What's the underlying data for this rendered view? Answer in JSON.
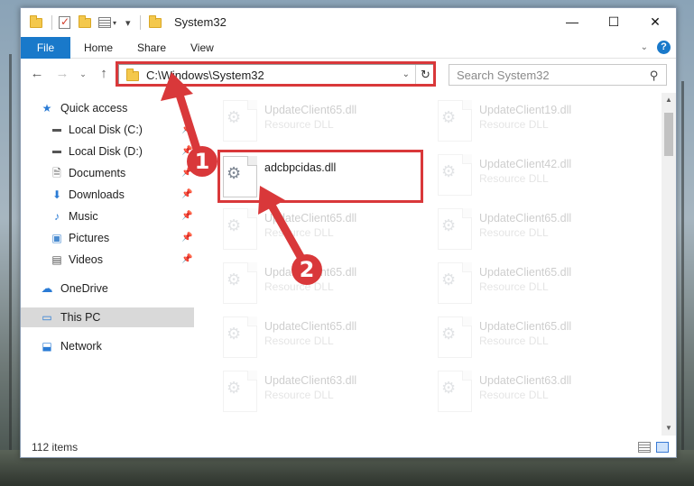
{
  "window": {
    "title": "System32",
    "controls": {
      "minimize": "—",
      "maximize": "☐",
      "close": "✕"
    }
  },
  "ribbon": {
    "file_tab": "File",
    "tabs": [
      "Home",
      "Share",
      "View"
    ],
    "help": "?"
  },
  "navbar": {
    "address": "C:\\Windows\\System32",
    "search_placeholder": "Search System32",
    "refresh": "↻"
  },
  "nav_pane": {
    "quick_access": "Quick access",
    "items": [
      {
        "label": "Local Disk (C:)",
        "pinned": true
      },
      {
        "label": "Local Disk (D:)",
        "pinned": true
      },
      {
        "label": "Documents",
        "pinned": true
      },
      {
        "label": "Downloads",
        "pinned": true
      },
      {
        "label": "Music",
        "pinned": true
      },
      {
        "label": "Pictures",
        "pinned": true
      },
      {
        "label": "Videos",
        "pinned": true
      }
    ],
    "onedrive": "OneDrive",
    "this_pc": "This PC",
    "network": "Network"
  },
  "files": {
    "highlighted": {
      "name": "adcbpcidas.dll",
      "type": ""
    },
    "left_column": [
      {
        "name": "UpdateClient65.dll",
        "type": "Resource DLL"
      },
      {
        "name": "UpdateClient65.dll",
        "type": "Resource DLL"
      },
      {
        "name": "UpdateClient65.dll",
        "type": "Resource DLL"
      },
      {
        "name": "UpdateClient65.dll",
        "type": "Resource DLL"
      },
      {
        "name": "UpdateClient63.dll",
        "type": "Resource DLL"
      }
    ],
    "right_column": [
      {
        "name": "UpdateClient19.dll",
        "type": "Resource DLL"
      },
      {
        "name": "UpdateClient42.dll",
        "type": "Resource DLL"
      },
      {
        "name": "UpdateClient65.dll",
        "type": "Resource DLL"
      },
      {
        "name": "UpdateClient65.dll",
        "type": "Resource DLL"
      },
      {
        "name": "UpdateClient65.dll",
        "type": "Resource DLL"
      },
      {
        "name": "UpdateClient63.dll",
        "type": "Resource DLL"
      }
    ]
  },
  "status": {
    "item_count": "112 items"
  },
  "annotations": {
    "step1": "1",
    "step2": "2",
    "color": "#d9383a"
  }
}
